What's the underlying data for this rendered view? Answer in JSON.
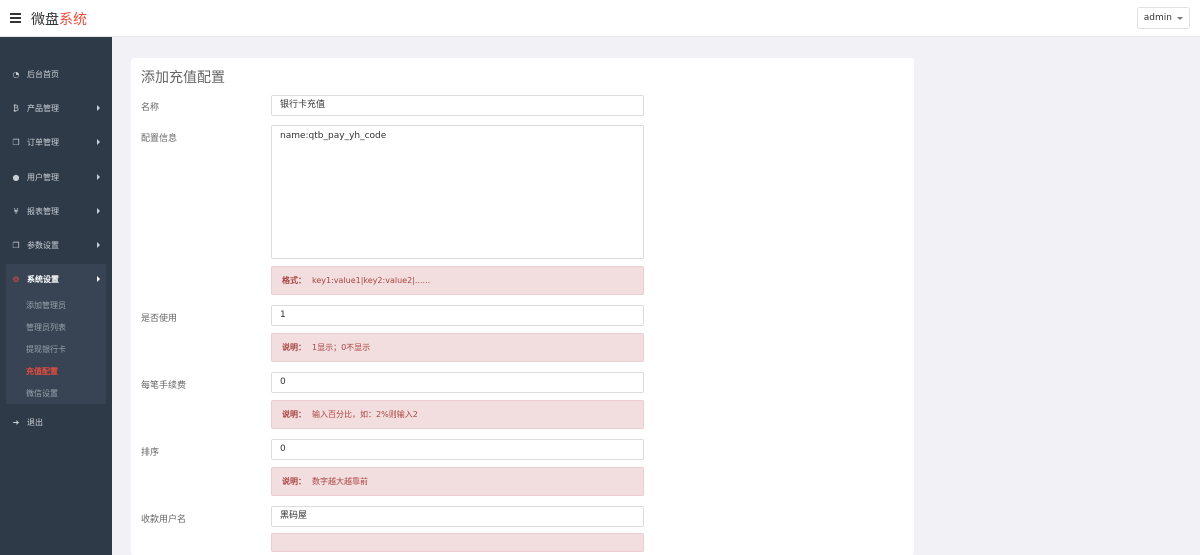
{
  "header": {
    "brand_main": "微盘",
    "brand_accent": "系统",
    "user": "admin"
  },
  "sidebar": {
    "items": [
      {
        "label": "后台首页",
        "icon": "dashboard-icon"
      },
      {
        "label": "产品管理",
        "icon": "bitcoin-icon"
      },
      {
        "label": "订单管理",
        "icon": "copy-icon"
      },
      {
        "label": "用户管理",
        "icon": "user-icon"
      },
      {
        "label": "报表管理",
        "icon": "yen-icon"
      },
      {
        "label": "参数设置",
        "icon": "copy-icon"
      },
      {
        "label": "系统设置",
        "icon": "gears-icon"
      },
      {
        "label": "退出",
        "icon": "sign-out-icon"
      }
    ],
    "submenu": [
      {
        "label": "添加管理员"
      },
      {
        "label": "管理员列表"
      },
      {
        "label": "提现银行卡"
      },
      {
        "label": "充值配置"
      },
      {
        "label": "微信设置"
      }
    ]
  },
  "form": {
    "title": "添加充值配置",
    "name_label": "名称",
    "name_value": "银行卡充值",
    "config_label": "配置信息",
    "config_value": "name:qtb_pay_yh_code",
    "config_hint_key": "格式：",
    "config_hint_text": "key1:value1|key2:value2|......",
    "enabled_label": "是否使用",
    "enabled_value": "1",
    "enabled_hint_key": "说明：",
    "enabled_hint_text": "1显示；0不显示",
    "fee_label": "每笔手续费",
    "fee_value": "0",
    "fee_hint_key": "说明：",
    "fee_hint_text": "输入百分比，如：2%则输入2",
    "sort_label": "排序",
    "sort_value": "0",
    "sort_hint_key": "说明：",
    "sort_hint_text": "数字越大越靠前",
    "payee_label": "收款用户名",
    "payee_value": "黑码屋"
  },
  "colors": {
    "accent": "#e74c3c",
    "sidebar_bg": "#2f3a48",
    "hint_bg": "#f2dede",
    "hint_text": "#a94442"
  }
}
